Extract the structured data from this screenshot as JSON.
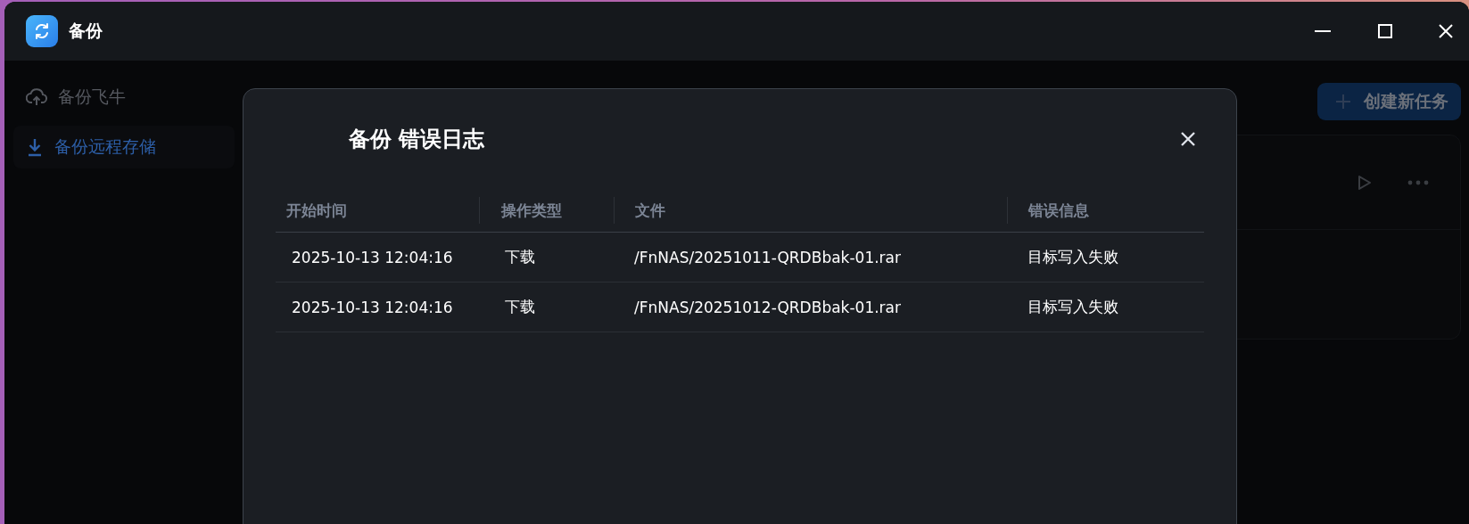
{
  "window": {
    "title": "备份"
  },
  "sidebar": {
    "items": [
      {
        "label": "备份飞牛",
        "kind": "upload",
        "selected": false
      },
      {
        "label": "备份远程存储",
        "kind": "download",
        "selected": true
      }
    ]
  },
  "toolbar": {
    "create_button": "创建新任务"
  },
  "dialog": {
    "title": "备份 错误日志",
    "table": {
      "columns": [
        "开始时间",
        "操作类型",
        "文件",
        "错误信息"
      ],
      "rows": [
        [
          "2025-10-13 12:04:16",
          "下载",
          "/FnNAS/20251011-QRDBbak-01.rar",
          "目标写入失败"
        ],
        [
          "2025-10-13 12:04:16",
          "下载",
          "/FnNAS/20251012-QRDBbak-01.rar",
          "目标写入失败"
        ]
      ]
    }
  }
}
